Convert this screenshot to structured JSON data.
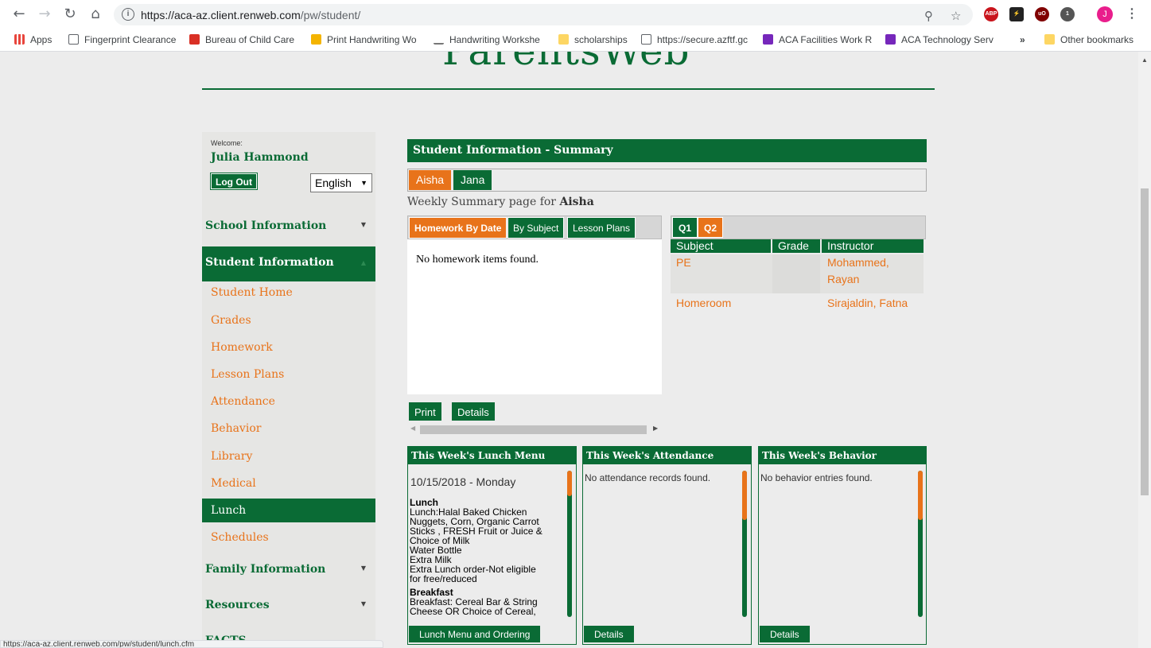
{
  "browser": {
    "url_host": "https://aca-az.client.renweb.com",
    "url_path": "/pw/student/",
    "avatar_letter": "J",
    "ext_badge": "1",
    "bookmarks": [
      {
        "label": "Apps",
        "icon": "apps-grid-icon",
        "color": "#e8453c"
      },
      {
        "label": "Fingerprint Clearance",
        "icon": "page-icon",
        "color": "#ffffff"
      },
      {
        "label": "Bureau of Child Care",
        "icon": "bookmark-red-icon",
        "color": "#d93025"
      },
      {
        "label": "Print Handwriting Wo",
        "icon": "handwriting-icon",
        "color": "#f4b400"
      },
      {
        "label": "Handwriting Workshe",
        "icon": "handwriting-sheet-icon",
        "color": "#777777"
      },
      {
        "label": "scholarships",
        "icon": "folder-icon",
        "color": "#fdd663"
      },
      {
        "label": "https://secure.azftf.gc",
        "icon": "page-icon",
        "color": "#ffffff"
      },
      {
        "label": "ACA Facilities Work R",
        "icon": "form-icon",
        "color": "#7627bb"
      },
      {
        "label": "ACA Technology Serv",
        "icon": "form-icon",
        "color": "#7627bb"
      }
    ],
    "more_bookmarks": "»",
    "other_bookmarks": "Other bookmarks",
    "status_url": "https://aca-az.client.renweb.com/pw/student/lunch.cfm"
  },
  "brand": {
    "title": "ParentsWeb",
    "color": "#0a6b35"
  },
  "sidebar": {
    "welcome": "Welcome:",
    "username": "Julia Hammond",
    "logout": "Log Out",
    "language": "English",
    "sections": {
      "school_info": "School Information",
      "student_info": "Student Information",
      "family_info": "Family Information",
      "resources": "Resources",
      "facts": "FACTS"
    },
    "items": [
      {
        "label": "Student Home",
        "active": false
      },
      {
        "label": "Grades",
        "active": false
      },
      {
        "label": "Homework",
        "active": false
      },
      {
        "label": "Lesson Plans",
        "active": false
      },
      {
        "label": "Attendance",
        "active": false
      },
      {
        "label": "Behavior",
        "active": false
      },
      {
        "label": "Library",
        "active": false
      },
      {
        "label": "Medical",
        "active": false
      },
      {
        "label": "Lunch",
        "active": true
      },
      {
        "label": "Schedules",
        "active": false
      }
    ]
  },
  "main": {
    "header": "Student Information - Summary",
    "students": [
      "Aisha",
      "Jana"
    ],
    "weekly_prefix": "Weekly Summary page for",
    "weekly_student": "Aisha",
    "homework_tabs": [
      "Homework By Date",
      "By Subject",
      "Lesson Plans"
    ],
    "homework_empty": "No homework items found.",
    "print": "Print",
    "details": "Details",
    "quarters": [
      "Q1",
      "Q2"
    ],
    "grade_headers": [
      "Subject",
      "Grade",
      "Instructor"
    ],
    "grade_rows": [
      {
        "subject": "PE",
        "grade": "",
        "instructor_1": "Mohammed,",
        "instructor_2": "Rayan"
      },
      {
        "subject": "Homeroom",
        "grade": "",
        "instructor_1": "Sirajaldin, Fatna",
        "instructor_2": ""
      }
    ]
  },
  "panels": {
    "lunch": {
      "title": "This Week's Lunch Menu",
      "date": "10/15/2018 - Monday",
      "lunch_heading": "Lunch",
      "lunch_lines": [
        "Lunch:Halal Baked Chicken",
        "Nuggets, Corn, Organic Carrot",
        "Sticks , FRESH Fruit or Juice &",
        "Choice of Milk",
        "Water Bottle",
        "Extra Milk",
        "Extra Lunch order-Not eligible",
        "for free/reduced"
      ],
      "breakfast_heading": "Breakfast",
      "breakfast_lines": [
        "Breakfast: Cereal Bar & String",
        "Cheese OR Choice of Cereal,"
      ],
      "button": "Lunch Menu and Ordering"
    },
    "attendance": {
      "title": "This Week's Attendance",
      "empty": "No attendance records found.",
      "button": "Details"
    },
    "behavior": {
      "title": "This Week's Behavior",
      "empty": "No behavior entries found.",
      "button": "Details"
    }
  },
  "colors": {
    "green": "#0a6b35",
    "orange": "#e8731a"
  }
}
